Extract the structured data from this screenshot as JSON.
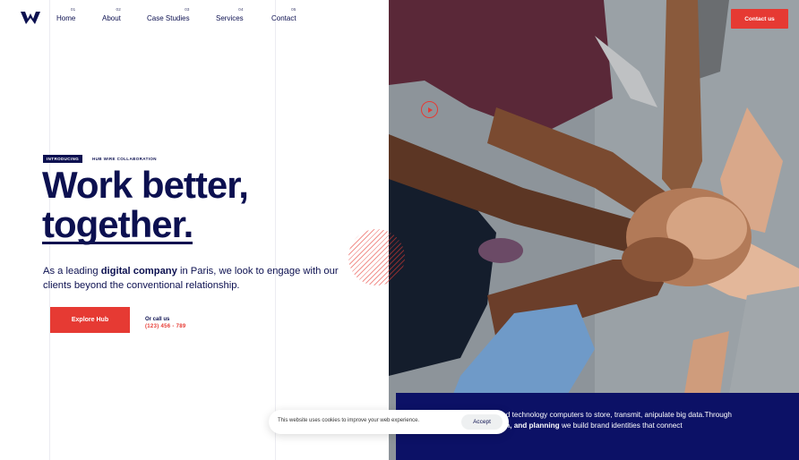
{
  "brand": {
    "logo_icon": "w-logo-icon"
  },
  "nav": {
    "items": [
      {
        "num": "01",
        "label": "Home"
      },
      {
        "num": "02",
        "label": "About"
      },
      {
        "num": "03",
        "label": "Case Studies"
      },
      {
        "num": "04",
        "label": "Services"
      },
      {
        "num": "05",
        "label": "Contact"
      }
    ]
  },
  "header": {
    "contact_button": "Contact us"
  },
  "hero": {
    "badge": "INTRODUCING",
    "badge_text": "HUB WIRE COLLABORATION",
    "title_line1": "Work better,",
    "title_line2": "together.",
    "lead_pre": "As a leading ",
    "lead_bold": "digital company",
    "lead_post": " in Paris, we look to engage with our clients beyond the conventional relationship.",
    "cta_button": "Explore Hub",
    "call_label": "Or call us",
    "call_phone": "(123) 456 - 789",
    "play_icon": "play-icon",
    "image_alt_icon": "team-hands-photo"
  },
  "info": {
    "text_pre": "our business and technology computers to store, transmit, anipulate big data.Through ",
    "text_bold": "strategy, design, and planning",
    "text_post": " we build brand identities that connect"
  },
  "cookie": {
    "text": "This website uses cookies to improve your web experience.",
    "accept": "Accept"
  },
  "colors": {
    "navy": "#0c1050",
    "accent": "#e63a33",
    "info_bg": "#0c1166"
  }
}
